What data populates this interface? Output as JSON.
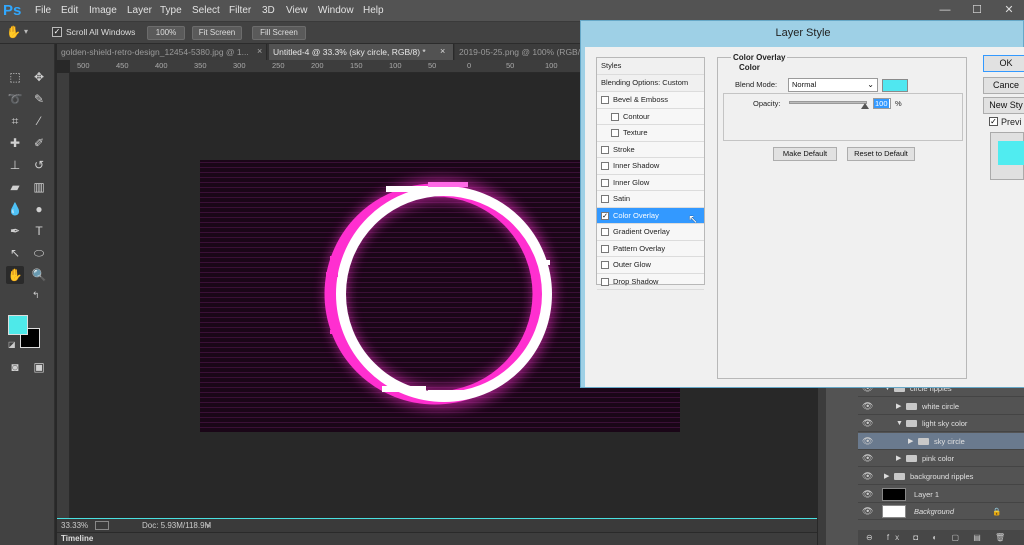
{
  "app": {
    "logo": "Ps"
  },
  "menubar": {
    "items": [
      "File",
      "Edit",
      "Image",
      "Layer",
      "Type",
      "Select",
      "Filter",
      "3D",
      "View",
      "Window",
      "Help"
    ]
  },
  "window_controls": {
    "minimize": "—",
    "maximize": "☐",
    "close": "✕"
  },
  "options_bar": {
    "tool_icon": "hand-icon",
    "scroll_all_windows": {
      "label": "Scroll All Windows",
      "checked": true
    },
    "buttons": [
      "100%",
      "Fit Screen",
      "Fill Screen"
    ]
  },
  "doc_tabs": [
    {
      "label": "golden-shield-retro-design_12454-5380.jpg @ 1...",
      "active": false
    },
    {
      "label": "Untitled-4 @ 33.3% (sky circle, RGB/8) *",
      "active": true
    },
    {
      "label": "2019-05-25.png @ 100% (RGB/...",
      "active": false
    }
  ],
  "ruler_top": [
    "500",
    "450",
    "400",
    "350",
    "300",
    "250",
    "200",
    "150",
    "100",
    "50",
    "0",
    "50",
    "100"
  ],
  "status": {
    "zoom": "33.33%",
    "doc": "Doc: 5.93M/118.9M"
  },
  "timeline": {
    "label": "Timeline"
  },
  "colors": {
    "foreground": "#4ee9e9",
    "background": "#000000",
    "ring": "#ff2fd0",
    "canvas_bg": "#1a0617",
    "accent": "#3399ff"
  },
  "layers": [
    {
      "name": "circle ripples",
      "indent": 0,
      "type": "group",
      "expanded": true,
      "selected": false
    },
    {
      "name": "white circle",
      "indent": 1,
      "type": "group",
      "expanded": false,
      "selected": false
    },
    {
      "name": "light sky color",
      "indent": 1,
      "type": "group",
      "expanded": true,
      "selected": false
    },
    {
      "name": "sky circle",
      "indent": 2,
      "type": "group",
      "expanded": false,
      "selected": true
    },
    {
      "name": "pink color",
      "indent": 1,
      "type": "group",
      "expanded": false,
      "selected": false
    },
    {
      "name": "background ripples",
      "indent": 0,
      "type": "group",
      "expanded": false,
      "selected": false
    },
    {
      "name": "Layer 1",
      "indent": 0,
      "type": "layer",
      "thumb": "#000000",
      "selected": false
    },
    {
      "name": "Background",
      "indent": 0,
      "type": "layer",
      "thumb": "#ffffff",
      "selected": false,
      "locked": true
    }
  ],
  "layers_bottom": "⊖ fx ◘ ◐ ▢ ▤ 🗑",
  "dialog": {
    "title": "Layer Style",
    "styles_header": "Styles",
    "blending_options": "Blending Options: Custom",
    "styles": [
      {
        "label": "Bevel & Emboss",
        "checked": false,
        "sub": false,
        "selected": false
      },
      {
        "label": "Contour",
        "checked": false,
        "sub": true,
        "selected": false
      },
      {
        "label": "Texture",
        "checked": false,
        "sub": true,
        "selected": false
      },
      {
        "label": "Stroke",
        "checked": false,
        "sub": false,
        "selected": false
      },
      {
        "label": "Inner Shadow",
        "checked": false,
        "sub": false,
        "selected": false
      },
      {
        "label": "Inner Glow",
        "checked": false,
        "sub": false,
        "selected": false
      },
      {
        "label": "Satin",
        "checked": false,
        "sub": false,
        "selected": false
      },
      {
        "label": "Color Overlay",
        "checked": true,
        "sub": false,
        "selected": true
      },
      {
        "label": "Gradient Overlay",
        "checked": false,
        "sub": false,
        "selected": false
      },
      {
        "label": "Pattern Overlay",
        "checked": false,
        "sub": false,
        "selected": false
      },
      {
        "label": "Outer Glow",
        "checked": false,
        "sub": false,
        "selected": false
      },
      {
        "label": "Drop Shadow",
        "checked": false,
        "sub": false,
        "selected": false
      }
    ],
    "color_overlay": {
      "group_title": "Color Overlay",
      "sub_title": "Color",
      "blend_mode_label": "Blend Mode:",
      "blend_mode_value": "Normal",
      "overlay_color": "#50e7f0",
      "opacity_label": "Opacity:",
      "opacity_value": "100",
      "opacity_unit": "%",
      "make_default": "Make Default",
      "reset_default": "Reset to Default"
    },
    "side_buttons": {
      "ok": "OK",
      "cancel": "Cance",
      "new_style": "New Sty",
      "preview": "Previ"
    }
  }
}
